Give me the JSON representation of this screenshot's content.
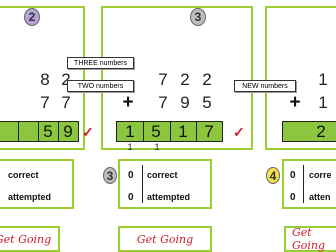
{
  "buttons": {
    "three_numbers": "THREE numbers",
    "two_numbers": "TWO numbers",
    "new_numbers": "NEW numbers"
  },
  "panel1": {
    "badge": "2",
    "row1": [
      "8",
      "2"
    ],
    "row2": [
      "7",
      "7"
    ],
    "answer": [
      "5",
      "9"
    ]
  },
  "panel2": {
    "badge": "3",
    "row1": [
      "7",
      "2",
      "2"
    ],
    "row2": [
      "7",
      "9",
      "5"
    ],
    "answer": [
      "1",
      "5",
      "1",
      "7"
    ],
    "carries": [
      "1",
      "1"
    ]
  },
  "panel3": {
    "row1": [
      "1"
    ],
    "row2": [
      "1"
    ],
    "answer": [
      "2"
    ]
  },
  "score1": {
    "correct_label": "correct",
    "attempted_label": "attempted"
  },
  "score2": {
    "badge": "3",
    "correct_value": "0",
    "attempted_value": "0",
    "correct_label": "correct",
    "attempted_label": "attempted"
  },
  "score3": {
    "badge": "4",
    "correct_value": "0",
    "attempted_value": "0",
    "correct_label": "corre",
    "attempted_label": "atten"
  },
  "go_label": "Get Going",
  "colors": {
    "accent_green": "#9acd32",
    "answer_green": "#8cc63f",
    "check_red": "#d0202a",
    "badge_purple": "#b6a4d8",
    "badge_gray": "#bdbdbd",
    "badge_yellow": "#f3e24a"
  }
}
